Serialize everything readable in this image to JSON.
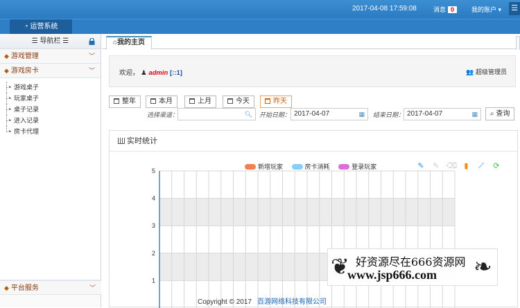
{
  "header": {
    "datetime": "2017-04-08 17:59:08",
    "messages_label": "消息",
    "messages_count": "0",
    "account_label": "我的账户",
    "nav_tab": "运营系统"
  },
  "sidebar": {
    "title": "导航栏",
    "groups": [
      {
        "label": "游戏管理"
      },
      {
        "label": "游戏房卡"
      }
    ],
    "items": [
      "游戏桌子",
      "玩家桌子",
      "桌子记录",
      "进入记录",
      "房卡代理"
    ],
    "bottom_group": "平台服务"
  },
  "tabs": {
    "home": "我的主页"
  },
  "welcome": {
    "prefix": "欢迎，",
    "user": "admin",
    "ip": "[::1]",
    "role": "超级管理员"
  },
  "filters": {
    "buttons": [
      "整年",
      "本月",
      "上月",
      "今天",
      "昨天"
    ],
    "active_button": "昨天",
    "channel_label": "选择渠道：",
    "start_label": "开始日期：",
    "start_value": "2017-04-07",
    "end_label": "结束日期：",
    "end_value": "2017-04-07",
    "query_label": "查询"
  },
  "panel": {
    "title": "实时统计"
  },
  "chart_data": {
    "type": "line",
    "title": "",
    "series": [
      {
        "name": "新增玩家",
        "color": "#f08050",
        "values": []
      },
      {
        "name": "房卡消耗",
        "color": "#87cefa",
        "values": []
      },
      {
        "name": "登录玩家",
        "color": "#da70d6",
        "values": []
      }
    ],
    "y_ticks": [
      "5",
      "4",
      "3",
      "2",
      "1"
    ],
    "ylim": [
      0,
      5
    ],
    "grid": true,
    "legend": "top"
  },
  "footer": {
    "copyright": "Copyright © 2017",
    "company": "百游网络科技有限公司"
  },
  "watermark": {
    "line1": "好资源尽在666资源网",
    "line2": "www.jsp666.com"
  }
}
